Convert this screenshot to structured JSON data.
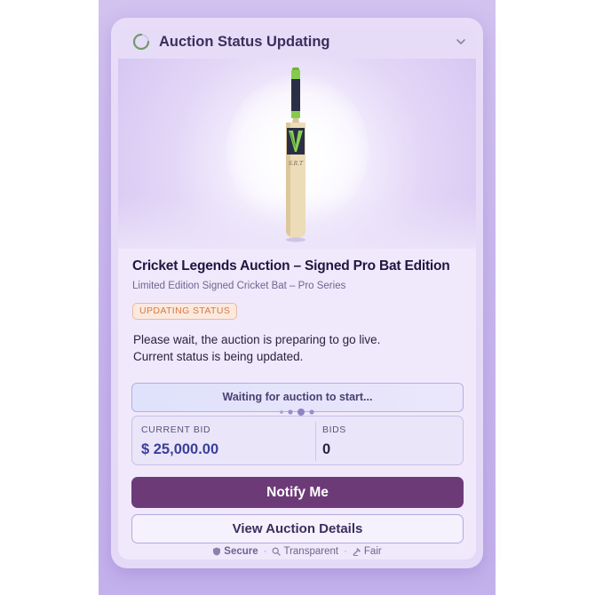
{
  "header": {
    "title": "Auction Status Updating",
    "icons": {
      "status": "loading-spinner-icon",
      "toggle": "chevron-down-icon"
    }
  },
  "item": {
    "image_alt": "Cricket bat",
    "title": "Cricket Legends Auction – Signed Pro Bat Edition",
    "subtitle": "Limited Edition Signed Cricket Bat – Pro Series"
  },
  "status": {
    "badge": "UPDATING STATUS",
    "message_line1": "Please wait, the auction is preparing to go live.",
    "message_line2": "Current status is being updated.",
    "waiting": "Waiting for auction to start..."
  },
  "stats": {
    "current_bid_label": "CURRENT BID",
    "current_bid_value": "$ 25,000.00",
    "bids_label": "BIDS",
    "bids_value": "0"
  },
  "actions": {
    "notify": "Notify Me",
    "details": "View Auction Details"
  },
  "footer": {
    "secure": "Secure",
    "transparent": "Transparent",
    "fair": "Fair",
    "separator": "·"
  },
  "colors": {
    "accent": "#6d3a78",
    "bid_value": "#3a3f9a",
    "bids_value": "#2a2340",
    "badge_text": "#d8793f",
    "badge_bg": "#fbe9df",
    "bat_grip": "#7fc743",
    "bat_logo": "#2f8a3a"
  }
}
